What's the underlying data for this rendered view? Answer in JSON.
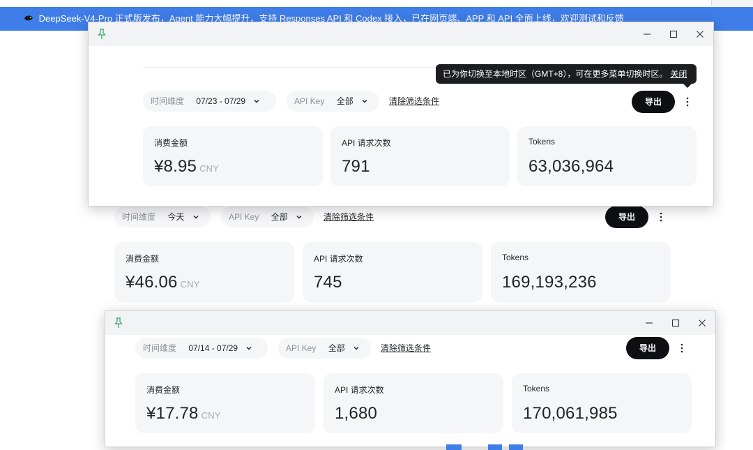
{
  "banner": {
    "text": "DeepSeek-V4-Pro 正式版发布，Agent 能力大幅提升，支持 Responses API 和 Codex 接入，已在网页端、APP 和 API 全面上线，欢迎测试和反馈"
  },
  "colors": {
    "banner": "#3f7ee8",
    "export_button": "#0e0f12",
    "card_bg": "#f5f6f8"
  },
  "windows": [
    {
      "has_titlebar": true,
      "time_filter": {
        "label": "时间维度",
        "value": "07/23 - 07/29"
      },
      "api_filter": {
        "label": "API Key",
        "value": "全部"
      },
      "clear_label": "清除筛选条件",
      "export_label": "导出",
      "tooltip": {
        "text": "已为你切换至本地时区（GMT+8），可在更多菜单切换时区。",
        "close_label": "关闭"
      },
      "cards": [
        {
          "title": "消费金额",
          "value": "¥8.95",
          "unit": "CNY"
        },
        {
          "title": "API 请求次数",
          "value": "791"
        },
        {
          "title": "Tokens",
          "value": "63,036,964"
        }
      ]
    },
    {
      "has_titlebar": false,
      "time_filter": {
        "label": "时间维度",
        "value": "今天"
      },
      "api_filter": {
        "label": "API Key",
        "value": "全部"
      },
      "clear_label": "清除筛选条件",
      "export_label": "导出",
      "cards": [
        {
          "title": "消费金额",
          "value": "¥46.06",
          "unit": "CNY"
        },
        {
          "title": "API 请求次数",
          "value": "745"
        },
        {
          "title": "Tokens",
          "value": "169,193,236"
        }
      ]
    },
    {
      "has_titlebar": true,
      "time_filter": {
        "label": "时间维度",
        "value": "07/14 - 07/29"
      },
      "api_filter": {
        "label": "API Key",
        "value": "全部"
      },
      "clear_label": "清除筛选条件",
      "export_label": "导出",
      "cards": [
        {
          "title": "消费金额",
          "value": "¥17.78",
          "unit": "CNY"
        },
        {
          "title": "API 请求次数",
          "value": "1,680"
        },
        {
          "title": "Tokens",
          "value": "170,061,985"
        }
      ]
    }
  ]
}
